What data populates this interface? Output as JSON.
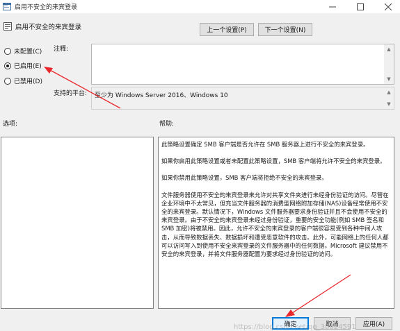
{
  "window": {
    "title": "启用不安全的来宾登录",
    "minimize_icon": "minimize-icon",
    "maximize_icon": "maximize-icon",
    "close_icon": "close-icon"
  },
  "header": {
    "policy_title": "启用不安全的来宾登录",
    "prev_setting": "上一个设置(P)",
    "next_setting": "下一个设置(N)"
  },
  "state": {
    "options": [
      {
        "label": "未配置(C)",
        "selected": false
      },
      {
        "label": "已启用(E)",
        "selected": true
      },
      {
        "label": "已禁用(D)",
        "selected": false
      }
    ]
  },
  "comment": {
    "label": "注释:",
    "value": ""
  },
  "supported": {
    "label": "支持的平台:",
    "value": "至少为 Windows Server 2016、Windows 10"
  },
  "options_panel": {
    "label": "选项:"
  },
  "help_panel": {
    "label": "帮助:",
    "paragraphs": [
      "此策略设置确定 SMB 客户端是否允许在 SMB 服务器上进行不安全的来宾登录。",
      "如果你启用此策略设置或者未配置此策略设置，SMB 客户端将允许不安全的来宾登录。",
      "如果你禁用此策略设置，SMB 客户端将拒绝不安全的来宾登录。",
      "文件服务器使用不安全的来宾登录来允许对共享文件夹进行未经身份验证的访问。尽管在企业环境中不太常见，但充当文件服务器的消费型网络附加存储(NAS)设备经常使用不安全的来宾登录。默认情况下，Windows 文件服务器要求身份验证并且不会使用不安全的来宾登录。由于不安全的来宾登录未经过身份验证，重要的安全功能(例如 SMB 签名和 SMB 加密)将被禁用。因此，允许不安全的来宾登录的客户端很容易受到各种中间人攻击，从而导致数据丢失、数据损坏和遭受恶意软件的攻击。此外，可能网络上的任何人都可以访问写入到使用不安全来宾登录的文件服务器中的任何数据。Microsoft 建议禁用不安全的来宾登录，并将文件服务器配置为要求经过身份验证的访问。"
    ]
  },
  "footer": {
    "ok": "确定",
    "cancel": "取消",
    "apply": "应用(A)"
  },
  "watermark": "https://blog.csdn.net/qq_30624591",
  "colors": {
    "annotation_arrow": "#e8262b",
    "default_button_border": "#0078d7"
  }
}
